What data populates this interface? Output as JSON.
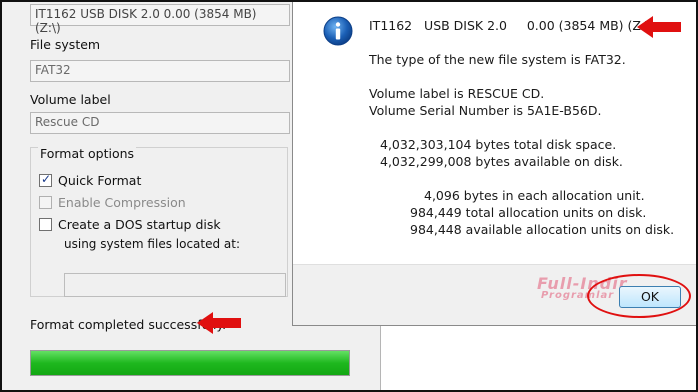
{
  "format_dialog": {
    "capacity_value": "IT1162   USB DISK 2.0     0.00 (3854 MB) (Z:\\)",
    "file_system_label": "File system",
    "file_system_value": "FAT32",
    "volume_label_label": "Volume label",
    "volume_label_value": "Rescue CD",
    "format_options_label": "Format options",
    "quick_format_label": "Quick Format",
    "quick_format_checked": true,
    "enable_compression_label": "Enable Compression",
    "enable_compression_checked": false,
    "dos_startup_label": "Create a DOS startup disk",
    "dos_startup_checked": false,
    "system_files_label": "using system files located at:",
    "status_text": "Format completed successfully.",
    "progress": 1.0
  },
  "message_box": {
    "icon": "info-icon",
    "line_title": "IT1162   USB DISK 2.0     0.00 (3854 MB) (Z:\\)",
    "line_fs": "The type of the new file system is FAT32.",
    "line_label": "Volume label is RESCUE CD.",
    "line_serial": "Volume Serial Number is 5A1E-B56D.",
    "line_total": "4,032,303,104 bytes total disk space.",
    "line_avail": "4,032,299,008 bytes available on disk.",
    "line_alloc_size": "4,096 bytes in each allocation unit.",
    "line_alloc_total": "984,449 total allocation units on disk.",
    "line_alloc_avail": "984,448 available allocation units on disk.",
    "ok_label": "OK"
  },
  "watermark": {
    "line1": "Full-Indir",
    "line2": "Programlar"
  },
  "colors": {
    "annotation_red": "#e01010",
    "progress_green": "#1fb81f",
    "info_blue": "#1b5fb5"
  }
}
